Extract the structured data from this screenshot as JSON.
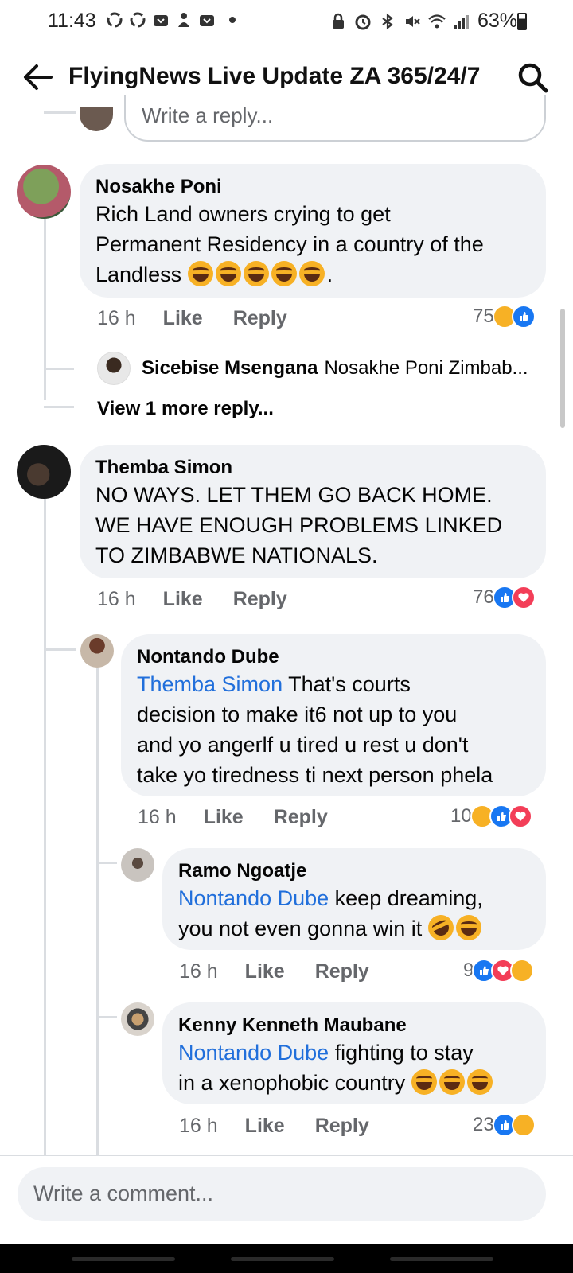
{
  "status_bar": {
    "time": "11:43",
    "battery": "63%"
  },
  "header": {
    "title": "FlyingNews Live Update ZA 365/24/7"
  },
  "reply_input_placeholder": "Write a reply...",
  "comments": [
    {
      "name": "Nosakhe Poni",
      "text_lines": [
        "Rich Land owners crying to get",
        "Permanent Residency in a country of the",
        "Landless"
      ],
      "text_suffix": ".",
      "time": "16 h",
      "like": "Like",
      "reply": "Reply",
      "reaction_count": "75",
      "reactions": [
        "haha-icon",
        "like-icon"
      ]
    },
    {
      "name": "Themba Simon",
      "text_lines": [
        "NO WAYS. LET THEM GO BACK HOME.",
        "WE HAVE ENOUGH PROBLEMS LINKED",
        "TO ZIMBABWE NATIONALS."
      ],
      "time": "16 h",
      "like": "Like",
      "reply": "Reply",
      "reaction_count": "76",
      "reactions": [
        "like-icon",
        "love-icon"
      ]
    }
  ],
  "collapsed_reply": {
    "name": "Sicebise Msengana",
    "text": "Nosakhe Poni Zimbab..."
  },
  "view_more": "View 1 more reply...",
  "replies": [
    {
      "name": "Nontando Dube",
      "mention": "Themba Simon",
      "text_first": " That's courts",
      "text_lines": [
        "decision to  make it6 not up to you",
        "and yo angerlf u tired u rest u don't",
        "take yo tiredness ti next person phela"
      ],
      "time": "16 h",
      "like": "Like",
      "reply": "Reply",
      "reaction_count": "10",
      "reactions": [
        "haha-icon",
        "like-icon",
        "love-icon"
      ]
    },
    {
      "name": "Ramo Ngoatje",
      "mention": "Nontando Dube",
      "text_first": " keep dreaming,",
      "text_lines": [
        "you not even gonna win it"
      ],
      "time": "16 h",
      "like": "Like",
      "reply": "Reply",
      "reaction_count": "9",
      "reactions": [
        "like-icon",
        "love-icon",
        "sad-icon"
      ]
    },
    {
      "name": "Kenny Kenneth Maubane",
      "mention": "Nontando Dube",
      "text_first": " fighting to stay",
      "text_lines": [
        "in a xenophobic country"
      ],
      "time": "16 h",
      "like": "Like",
      "reply": "Reply",
      "reaction_count": "23",
      "reactions": [
        "like-icon",
        "haha-icon"
      ]
    }
  ],
  "composer_placeholder": "Write a comment...",
  "colors": {
    "mention": "#216fdb",
    "bubble": "#f0f2f5",
    "like": "#1877f2",
    "love": "#f33e58",
    "haha": "#f7b125"
  }
}
